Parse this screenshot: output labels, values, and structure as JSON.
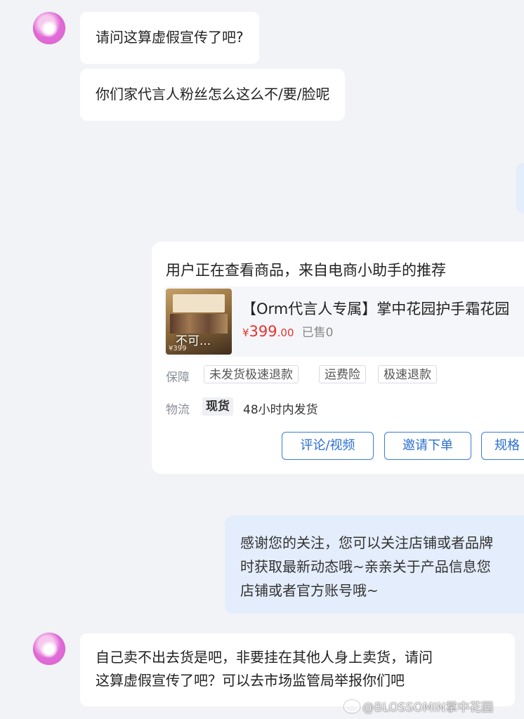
{
  "chat": {
    "messages": [
      {
        "text": "请问这算虚假宣传了吧?"
      },
      {
        "text": "你们家代言人粉丝怎么这么不/要/脸呢"
      }
    ],
    "product_card": {
      "header": "用户正在查看商品，来自电商小助手的推荐",
      "product_title": "【Orm代言人专属】掌中花园护手霜花园",
      "currency_symbol": "¥",
      "price_int": "399",
      "price_dec": ".00",
      "sold": "已售0",
      "thumb_overlay": "不可...",
      "thumb_price": "¥399",
      "guarantee_label": "保障",
      "guarantee_tags": [
        "未发货极速退款",
        "运费险",
        "极速退款"
      ],
      "logistics_label": "物流",
      "logistics_badge": "现货",
      "logistics_text": "48小时内发货",
      "buttons": [
        "评论/视频",
        "邀请下单",
        "规格"
      ]
    },
    "reply": {
      "lines": [
        "感谢您的关注，您可以关注店铺或者品牌",
        "时获取最新动态哦~亲亲关于产品信息您",
        "店铺或者官方账号哦~"
      ]
    },
    "last_message": {
      "lines": [
        "自己卖不出去货是吧，非要挂在其他人身上卖货，请问",
        "这算虚假宣传了吧？可以去市场监管局举报你们吧"
      ]
    }
  },
  "watermark": "@BLOSSOMIN掌中花园",
  "colors": {
    "page_bg": "#f2f3f7",
    "outgoing_bubble": "#e4edfb",
    "price_red": "#e8332e",
    "button_blue": "#2b6fd3"
  }
}
